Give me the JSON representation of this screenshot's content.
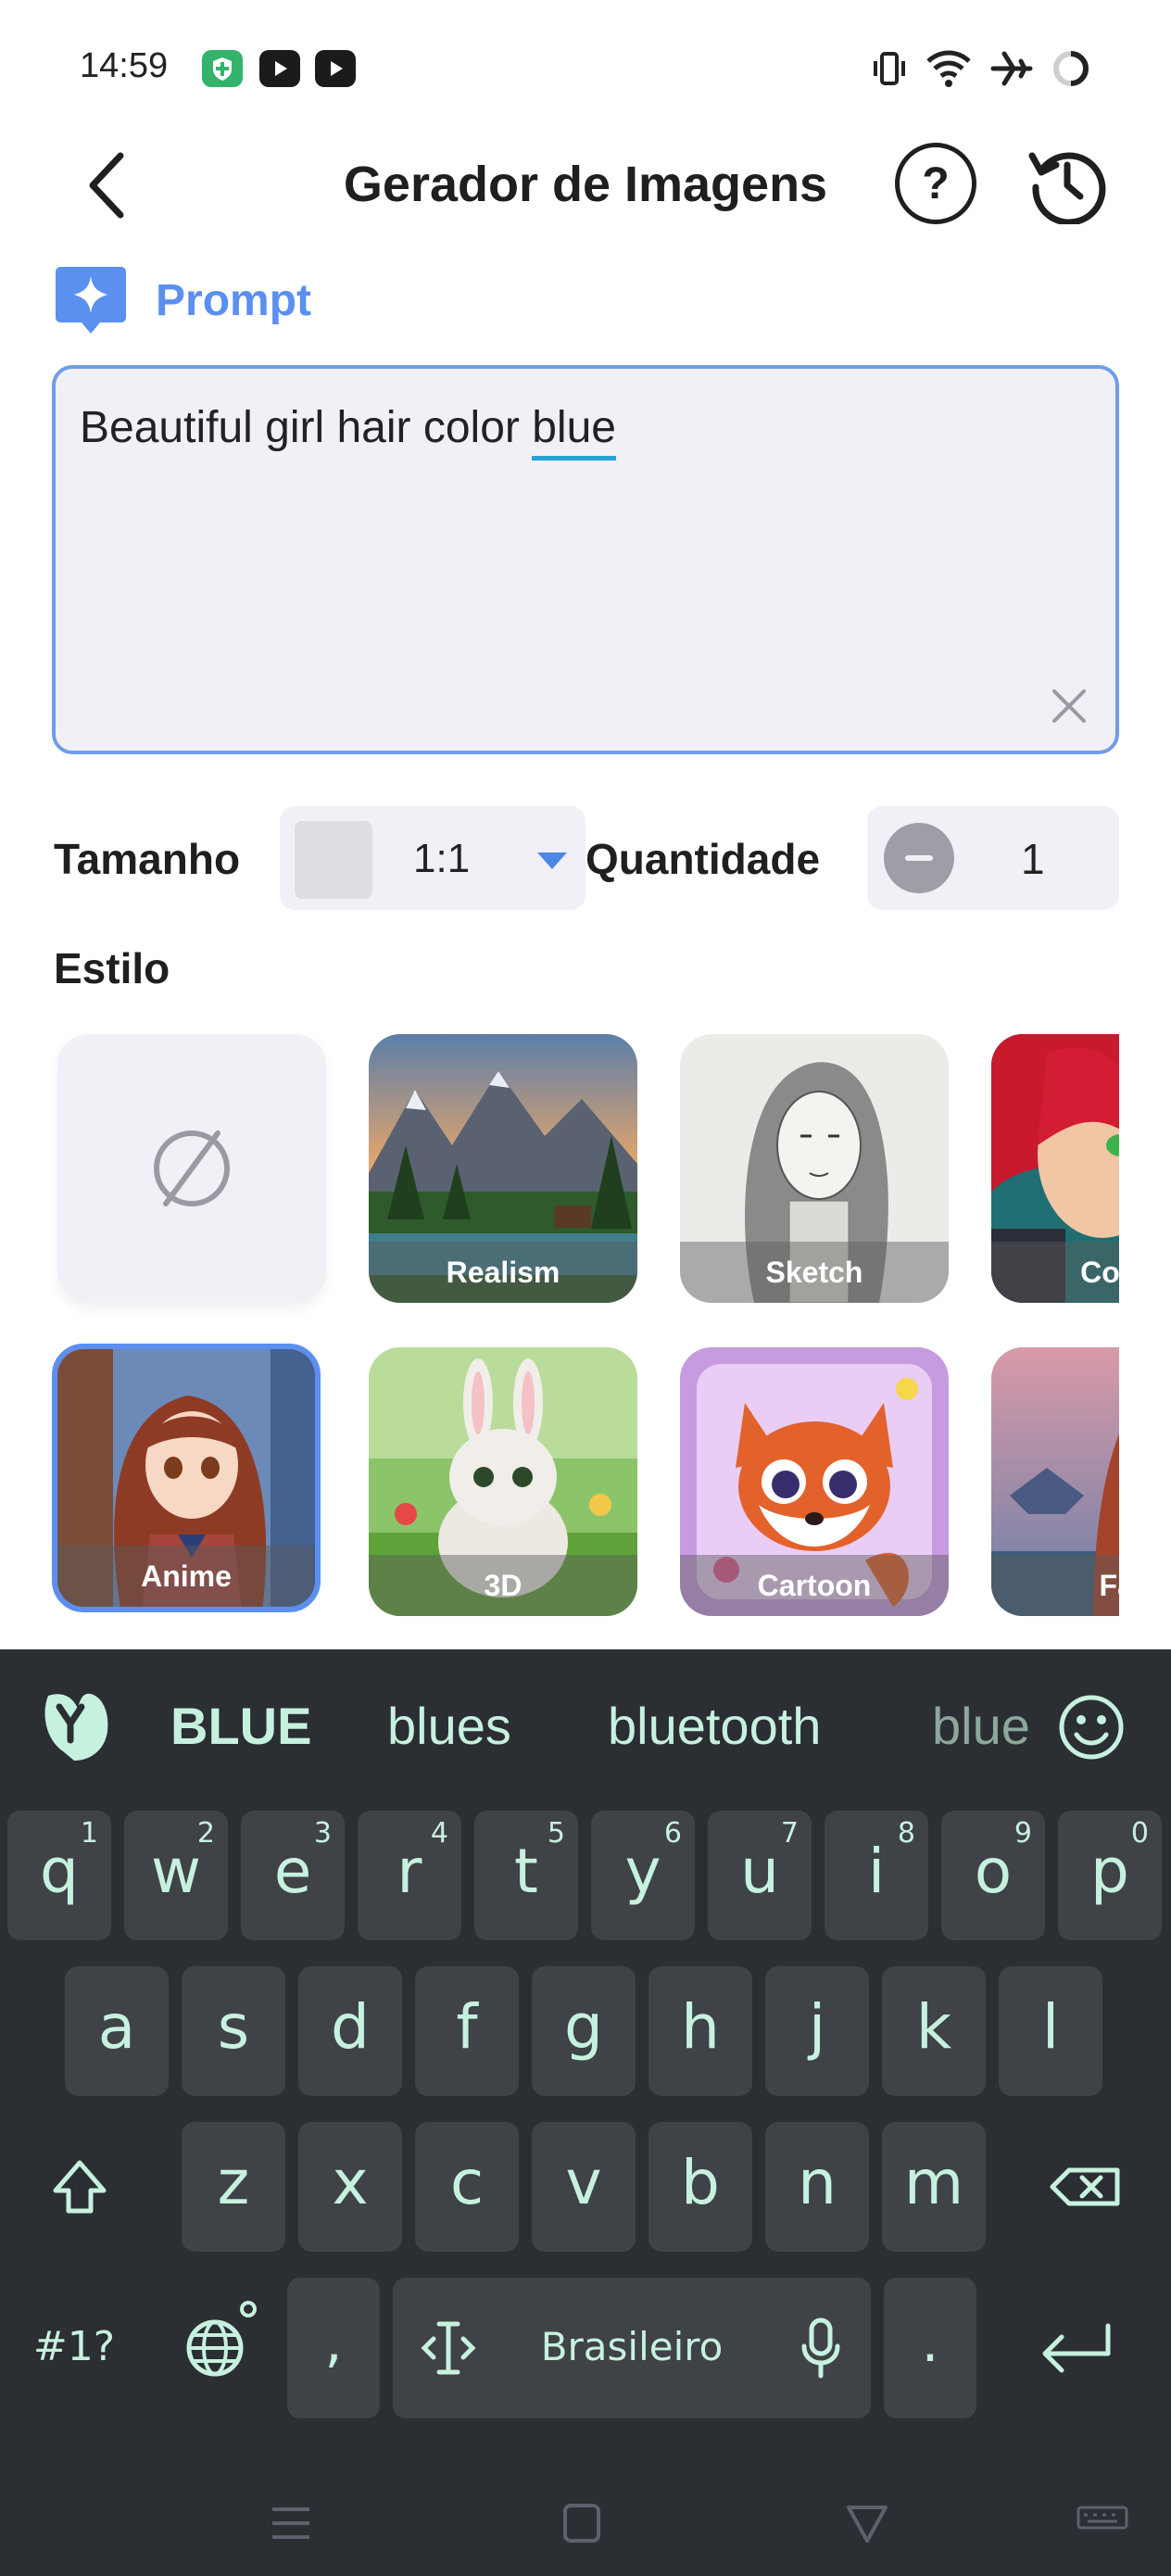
{
  "status_bar": {
    "time": "14:59",
    "apps": [
      {
        "icon": "vpn-shield-icon",
        "color": "#33b36b"
      },
      {
        "icon": "youtube-icon",
        "color": "#1b1b1b"
      },
      {
        "icon": "youtube-icon",
        "color": "#1b1b1b"
      }
    ],
    "indicators": [
      "vibrate-icon",
      "wifi-icon",
      "airplane-icon",
      "battery-ring-icon"
    ]
  },
  "header": {
    "title": "Gerador de Imagens",
    "back_icon": "chevron-left-icon",
    "help_label": "?",
    "history_icon": "history-clock-icon"
  },
  "prompt": {
    "label": "Prompt",
    "text_before": "Beautiful girl hair color ",
    "text_underlined": "blue",
    "clear_icon": "close-icon"
  },
  "options": {
    "size_label": "Tamanho",
    "size_value": "1:1",
    "quantity_label": "Quantidade",
    "quantity_value": "1"
  },
  "style": {
    "label": "Estilo",
    "tiles": [
      {
        "name": "none",
        "label": ""
      },
      {
        "name": "realism",
        "label": "Realism"
      },
      {
        "name": "sketch",
        "label": "Sketch"
      },
      {
        "name": "comic",
        "label": "Comic"
      },
      {
        "name": "anime",
        "label": "Anime",
        "selected": true
      },
      {
        "name": "3d",
        "label": "3D"
      },
      {
        "name": "cartoon",
        "label": "Cartoon"
      },
      {
        "name": "fantasy",
        "label": "Fan"
      }
    ]
  },
  "keyboard": {
    "suggestions": [
      "BLUE",
      "blues",
      "bluetooth",
      "blue"
    ],
    "row1": [
      {
        "key": "q",
        "sup": "1"
      },
      {
        "key": "w",
        "sup": "2"
      },
      {
        "key": "e",
        "sup": "3"
      },
      {
        "key": "r",
        "sup": "4"
      },
      {
        "key": "t",
        "sup": "5"
      },
      {
        "key": "y",
        "sup": "6"
      },
      {
        "key": "u",
        "sup": "7"
      },
      {
        "key": "i",
        "sup": "8"
      },
      {
        "key": "o",
        "sup": "9"
      },
      {
        "key": "p",
        "sup": "0"
      }
    ],
    "row2": [
      "a",
      "s",
      "d",
      "f",
      "g",
      "h",
      "j",
      "k",
      "l"
    ],
    "row3": [
      "z",
      "x",
      "c",
      "v",
      "b",
      "n",
      "m"
    ],
    "symbols_label": "#1?",
    "comma": ",",
    "space_label": "Brasileiro",
    "period": ".",
    "accent_color": "#c7f1df",
    "background": "#2b2e33"
  }
}
